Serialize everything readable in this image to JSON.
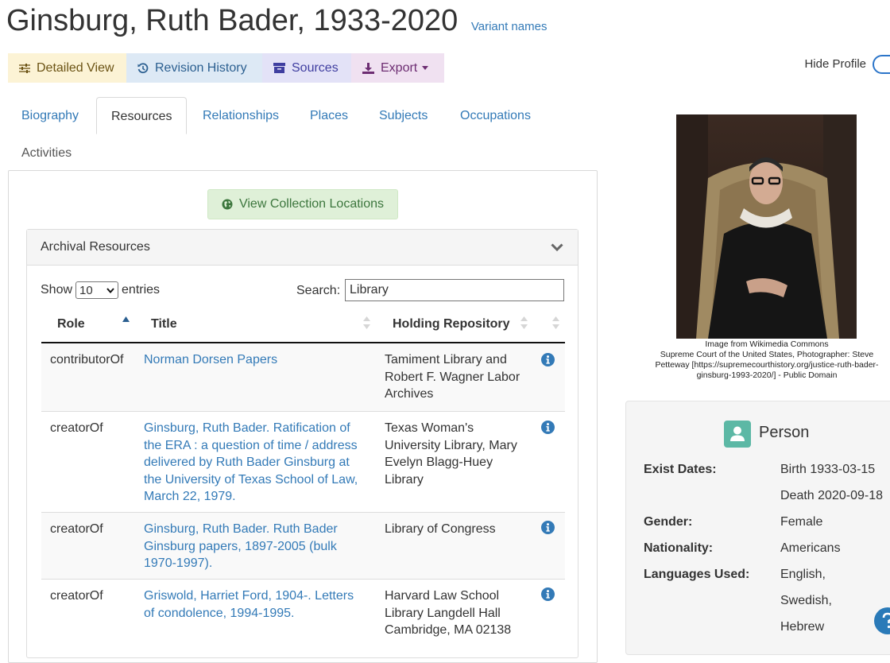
{
  "header": {
    "title": "Ginsburg, Ruth Bader, 1933-2020",
    "variant_link": "Variant names"
  },
  "actions": {
    "detailed_view": "Detailed View",
    "revision_history": "Revision History",
    "sources": "Sources",
    "export": "Export"
  },
  "hide_profile": {
    "label": "Hide Profile",
    "enabled": true
  },
  "tabs": {
    "biography": "Biography",
    "resources": "Resources",
    "relationships": "Relationships",
    "places": "Places",
    "subjects": "Subjects",
    "occupations": "Occupations",
    "activities": "Activities"
  },
  "content": {
    "view_collection_locations": "View Collection Locations",
    "archival_resources": "Archival Resources",
    "show": "Show",
    "entries": "entries",
    "page_length": "10",
    "search_label": "Search:",
    "search_value": "Library",
    "columns": {
      "role": "Role",
      "title": "Title",
      "holding_repository": "Holding Repository"
    },
    "rows": [
      {
        "role": "contributorOf",
        "title_lines": [
          "Norman Dorsen Papers"
        ],
        "repo_lines": [
          "Tamiment Library and",
          "Robert F. Wagner Labor",
          "Archives"
        ]
      },
      {
        "role": "creatorOf",
        "title_lines": [
          "Ginsburg, Ruth Bader. Ratification of",
          "the ERA : a question of time / address",
          "delivered by Ruth Bader Ginsburg at",
          "the University of Texas School of Law,",
          "March 22, 1979."
        ],
        "repo_lines": [
          "Texas Woman's",
          "University Library, Mary",
          "Evelyn Blagg-Huey",
          "Library"
        ]
      },
      {
        "role": "creatorOf",
        "title_lines": [
          "Ginsburg, Ruth Bader. Ruth Bader",
          "Ginsburg papers, 1897-2005 (bulk",
          "1970-1997)."
        ],
        "repo_lines": [
          "Library of Congress"
        ]
      },
      {
        "role": "creatorOf",
        "title_lines": [
          "Griswold, Harriet Ford, 1904-. Letters",
          "of condolence, 1994-1995."
        ],
        "repo_lines": [
          "Harvard Law School",
          "Library Langdell Hall",
          "Cambridge, MA 02138"
        ]
      }
    ]
  },
  "profile": {
    "caption_lines": [
      "Image from Wikimedia Commons",
      "Supreme Court of the United States, Photographer: Steve",
      "Petteway [https://supremecourthistory.org/justice-ruth-bader-",
      "ginsburg-1993-2020/] - Public Domain"
    ],
    "person_title": "Person",
    "labels": {
      "exist_dates": "Exist Dates:",
      "gender": "Gender:",
      "nationality": "Nationality:",
      "languages_used": "Languages Used:"
    },
    "values": {
      "birth": "Birth 1933-03-15",
      "death": "Death 2020-09-18",
      "gender": "Female",
      "nationality": "Americans",
      "languages": [
        "English,",
        "Swedish,",
        "Hebrew"
      ]
    }
  },
  "colors": {
    "link": "#337ab7",
    "detailed_view_bg": "#fcf3d5",
    "revision_history_bg": "#dde9f5",
    "sources_bg": "#e3e2f7",
    "export_bg": "#f0e1f1",
    "success_bg": "#dff0d8",
    "info_icon": "#337ab7",
    "person_icon": "#5cb8a5"
  },
  "icons": {
    "detailed_view": "sliders-icon",
    "revision_history": "history-icon",
    "sources": "archive-box-icon",
    "export": "download-icon",
    "view_collection_locations": "globe-icon",
    "collapse": "chevron-down-icon",
    "row_info": "info-circle-icon",
    "person": "user-icon",
    "help": "help-icon"
  }
}
